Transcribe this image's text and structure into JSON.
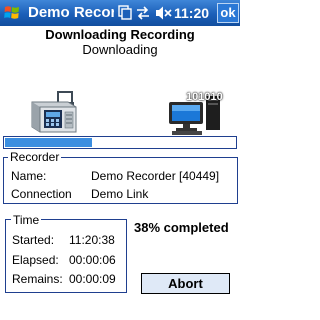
{
  "titlebar": {
    "title": "Demo Recorde",
    "clock": "11:20",
    "ok_label": "ok",
    "icons": [
      "windows-start-icon",
      "app-switch-icon",
      "connectivity-icon",
      "speaker-muted-icon"
    ]
  },
  "heading": "Downloading Recording",
  "subheading": "Downloading",
  "illustration": {
    "device_icon": "recorder-device-icon",
    "computer_icon": "computer-icon",
    "binary_text": "101010"
  },
  "progress": {
    "fraction": 0.38,
    "fill_color": "#3b8ee0"
  },
  "recorder": {
    "legend": "Recorder",
    "name_label": "Name:",
    "name_value": "Demo Recorder [40449]",
    "connection_label": "Connection",
    "connection_value": "Demo Link"
  },
  "time": {
    "legend": "Time",
    "started_label": "Started:",
    "started_value": "11:20:38",
    "elapsed_label": "Elapsed:",
    "elapsed_value": "00:00:06",
    "remains_label": "Remains:",
    "remains_value": "00:00:09"
  },
  "status": {
    "percent_text": "38% completed"
  },
  "abort_label": "Abort"
}
